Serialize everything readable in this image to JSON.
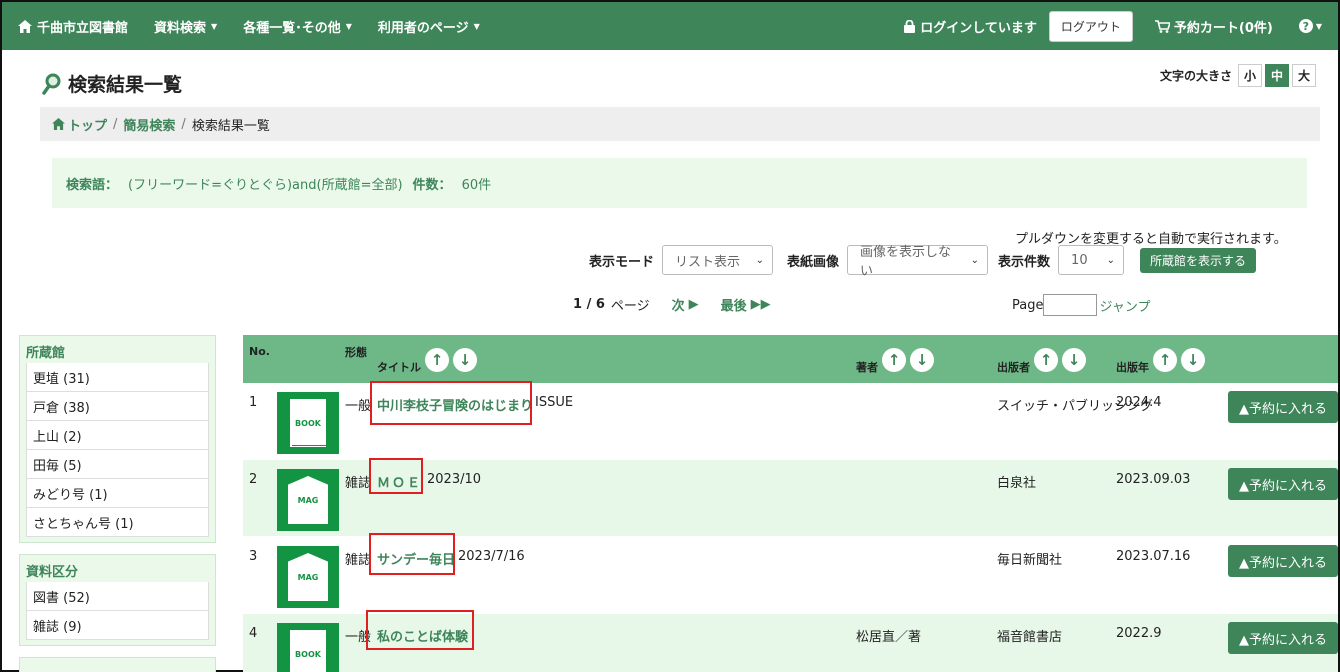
{
  "navbar": {
    "brand": "千曲市立図書館",
    "menu": [
      {
        "label": "資料検索"
      },
      {
        "label": "各種一覧･その他"
      },
      {
        "label": "利用者のページ"
      }
    ],
    "login_status": "ログインしています",
    "logout": "ログアウト",
    "cart": "予約カート(0件)"
  },
  "page": {
    "title": "検索結果一覧",
    "fontsize_label": "文字の大きさ",
    "fontsize_options": [
      "小",
      "中",
      "大"
    ],
    "fontsize_selected": "中"
  },
  "breadcrumb": {
    "home": "トップ",
    "simple_search": "簡易検索",
    "current": "検索結果一覧",
    "sep": "/"
  },
  "search_info": {
    "label": "検索語：",
    "query": "(フリーワード=ぐりとぐら)and(所蔵館=全部)",
    "count_label": "件数：",
    "count": "60件"
  },
  "controls": {
    "auto_note": "プルダウンを変更すると自動で実行されます。",
    "display_mode_label": "表示モード",
    "display_mode_value": "リスト表示",
    "cover_label": "表紙画像",
    "cover_value": "画像を表示しない",
    "per_page_label": "表示件数",
    "per_page_value": "10",
    "holdings_button": "所蔵館を表示する"
  },
  "pager": {
    "current": "1 / 6",
    "pages_word": "ページ",
    "next": "次",
    "last": "最後",
    "page_label": "Page",
    "jump": "ジャンプ"
  },
  "facets": [
    {
      "title": "所蔵館",
      "items": [
        "更埴 (31)",
        "戸倉 (38)",
        "上山 (2)",
        "田毎 (5)",
        "みどり号 (1)",
        "さとちゃん号 (1)"
      ]
    },
    {
      "title": "資料区分",
      "items": [
        "図書 (52)",
        "雑誌 (9)"
      ]
    }
  ],
  "table": {
    "headers": {
      "no": "No.",
      "type": "形態",
      "title": "タイトル",
      "author": "著者",
      "publisher": "出版者",
      "year": "出版年"
    },
    "reserve_label": "▲予約に入れる",
    "rows": [
      {
        "no": "1",
        "icon": "BOOK",
        "type": "一般",
        "title": "中川李枝子冒険のはじまり",
        "title_suffix": "ISSUE",
        "author": "",
        "publisher": "スイッチ・パブリッシング",
        "year": "2024.4"
      },
      {
        "no": "2",
        "icon": "MAG",
        "type": "雑誌",
        "title": "ＭＯＥ",
        "title_suffix": "2023/10",
        "author": "",
        "publisher": "白泉社",
        "year": "2023.09.03"
      },
      {
        "no": "3",
        "icon": "MAG",
        "type": "雑誌",
        "title": "サンデー毎日",
        "title_suffix": "2023/7/16",
        "author": "",
        "publisher": "毎日新聞社",
        "year": "2023.07.16"
      },
      {
        "no": "4",
        "icon": "BOOK",
        "type": "一般",
        "title": "私のことば体験",
        "title_suffix": "",
        "author": "松居直／著",
        "publisher": "福音館書店",
        "year": "2022.9"
      }
    ]
  }
}
